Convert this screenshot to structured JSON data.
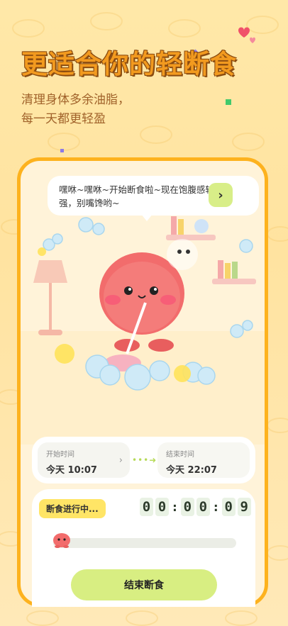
{
  "promo": {
    "title": "更适合你的轻断食",
    "subtitle_line1": "清理身体多余油脂，",
    "subtitle_line2": "每一天都更轻盈"
  },
  "speech": {
    "text": "嘿咻~嘿咻~开始断食啦~现在饱腹感较强，别嘴馋哟~",
    "next_icon": "chevron-right-icon"
  },
  "schedule": {
    "start_label": "开始时间",
    "start_value": "今天 10:07",
    "end_label": "结束时间",
    "end_value": "今天 22:07"
  },
  "fasting": {
    "status": "断食进行中...",
    "timer_digits": [
      "0",
      "0",
      "0",
      "0",
      "0",
      "9"
    ],
    "progress": 0.0,
    "end_button": "结束断食"
  },
  "colors": {
    "accent_orange": "#FDB21E",
    "accent_green": "#D8EE82",
    "badge_yellow": "#FFE566",
    "mascot_pink": "#F26C6C"
  }
}
